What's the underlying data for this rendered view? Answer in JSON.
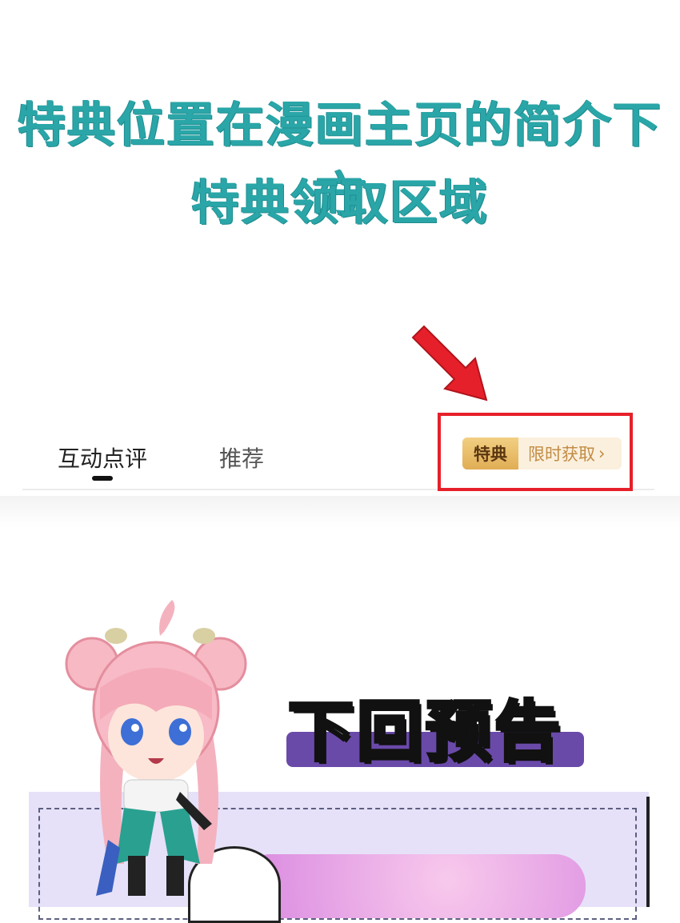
{
  "headline": {
    "line1": "特典位置在漫画主页的简介下方",
    "line2": "特典领取区域"
  },
  "tabs": [
    {
      "label": "互动点评",
      "active": true
    },
    {
      "label": "推荐",
      "active": false
    }
  ],
  "perk": {
    "badge": "特典",
    "action": "限时获取",
    "chevron": "›"
  },
  "preview": {
    "title": "下回预告"
  },
  "colors": {
    "headline": "#2aa6a8",
    "highlight": "#e6202a",
    "arrow": "#e6202a",
    "badge_gold": "#e0ad55",
    "preview_bar": "#6a4aa9"
  },
  "icons": {
    "pointer": "red-arrow-icon",
    "mascot": "chibi-character-illustration"
  }
}
